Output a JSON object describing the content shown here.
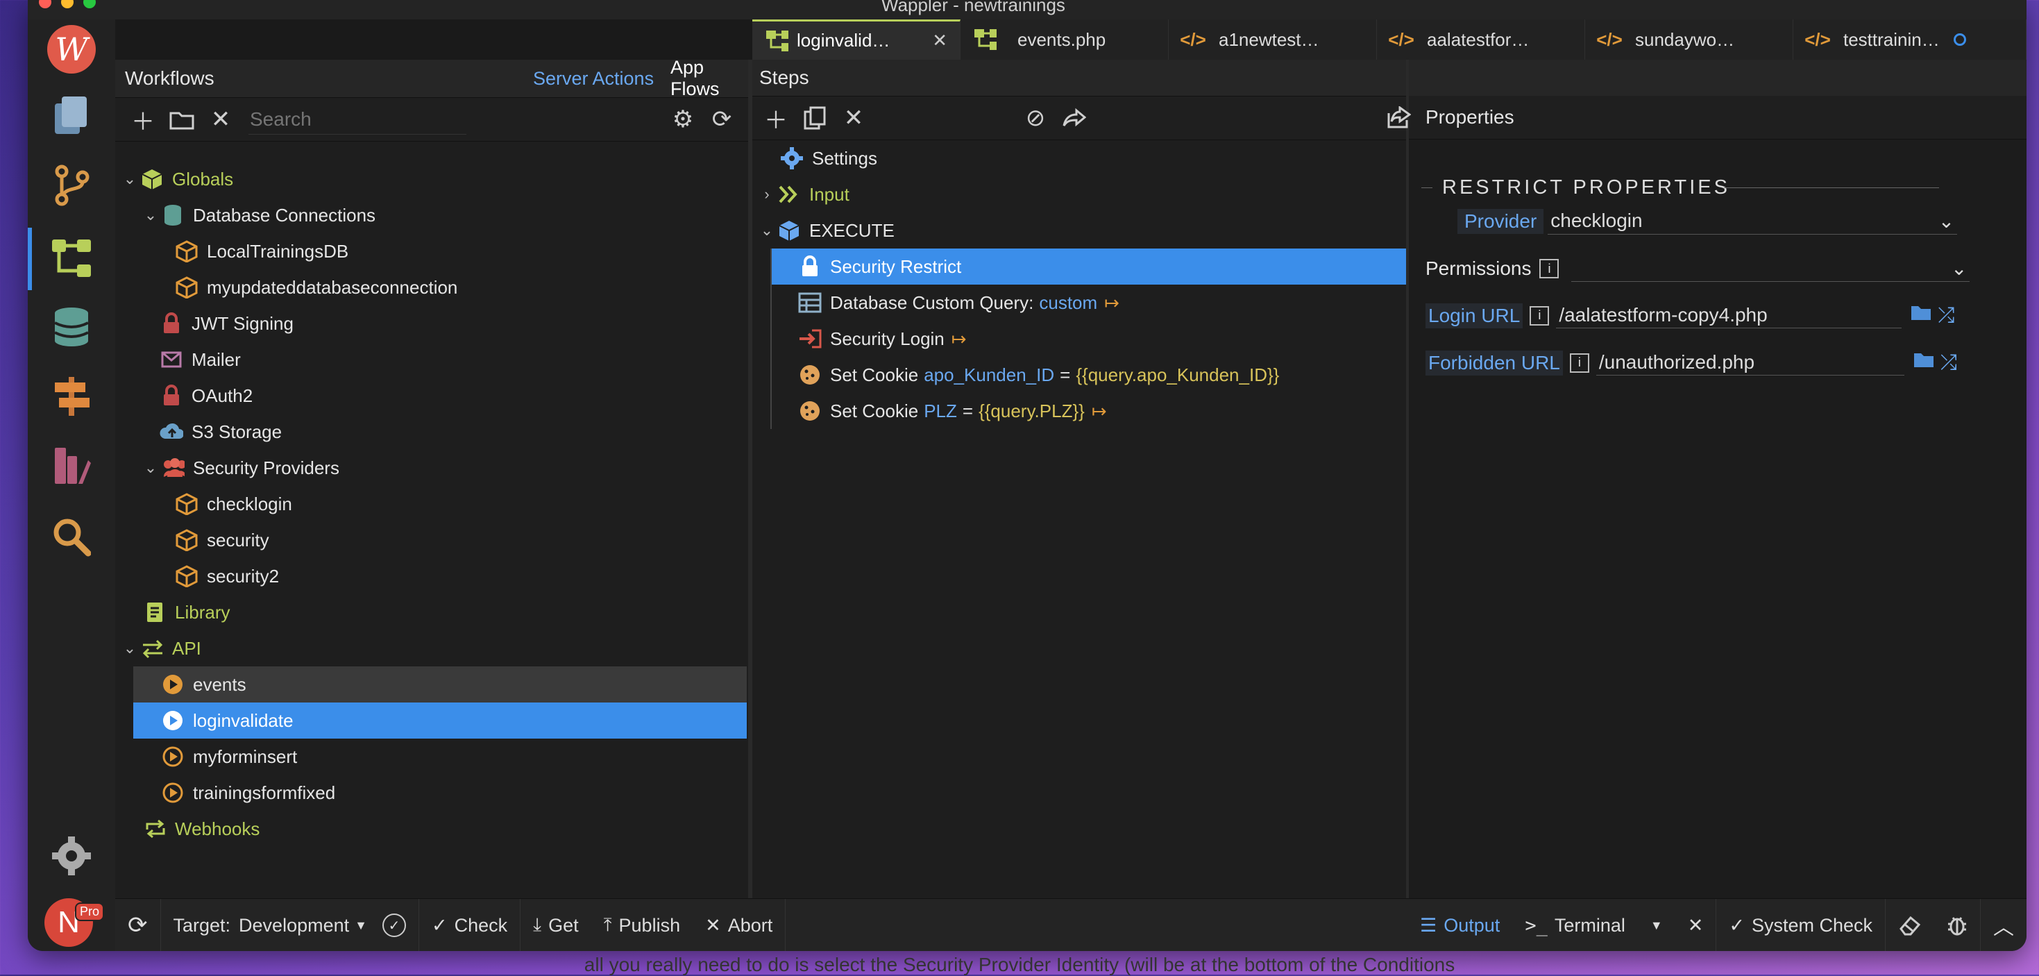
{
  "window": {
    "title": "Wappler - newtrainings"
  },
  "tabs": [
    {
      "label": "loginvalid…",
      "close": "✕"
    },
    {
      "label": "events.php"
    },
    {
      "label": "a1newtest…"
    },
    {
      "label": "aalatestfor…"
    },
    {
      "label": "sundaywo…"
    },
    {
      "label": "testtrainin…"
    }
  ],
  "workflows": {
    "title": "Workflows",
    "server_actions": "Server Actions",
    "app_flows": "App Flows",
    "search_placeholder": "Search",
    "tree": [
      "Globals",
      "Database Connections",
      "LocalTrainingsDB",
      "myupdateddatabaseconnection",
      "JWT Signing",
      "Mailer",
      "OAuth2",
      "S3 Storage",
      "Security Providers",
      "checklogin",
      "security",
      "security2",
      "Library",
      "API",
      "events",
      "loginvalidate",
      "myforminsert",
      "trainingsformfixed",
      "Webhooks"
    ]
  },
  "steps": {
    "title": "Steps",
    "items": {
      "settings": "Settings",
      "input": "Input",
      "execute": "EXECUTE",
      "restrict": "Security Restrict",
      "query_label": "Database Custom Query:",
      "query_value": "custom",
      "login": "Security Login",
      "cookie1_label": "Set Cookie",
      "cookie1_name": "apo_Kunden_ID",
      "cookie1_eq": "=",
      "cookie1_value": "{{query.apo_Kunden_ID}}",
      "cookie2_label": "Set Cookie",
      "cookie2_name": "PLZ",
      "cookie2_eq": "=",
      "cookie2_value": "{{query.PLZ}}"
    }
  },
  "properties": {
    "title": "Properties",
    "section": "RESTRICT PROPERTIES",
    "provider_label": "Provider",
    "provider_value": "checklogin",
    "permissions_label": "Permissions",
    "login_url_label": "Login URL",
    "login_url_value": "/aalatestform-copy4.php",
    "forbidden_url_label": "Forbidden URL",
    "forbidden_url_value": "/unauthorized.php"
  },
  "statusbar": {
    "target_label": "Target:",
    "target_value": "Development",
    "check": "Check",
    "get": "Get",
    "publish": "Publish",
    "abort": "Abort",
    "output": "Output",
    "terminal": "Terminal",
    "system_check": "System Check"
  },
  "avatar": {
    "initial": "N",
    "badge": "Pro"
  },
  "caption": "all you really need to do is select the Security Provider Identity (will be at the bottom of the Conditions",
  "colors": {
    "accent": "#3b8eea",
    "globals": "#b8cf5a",
    "link": "#6aa8f0"
  }
}
